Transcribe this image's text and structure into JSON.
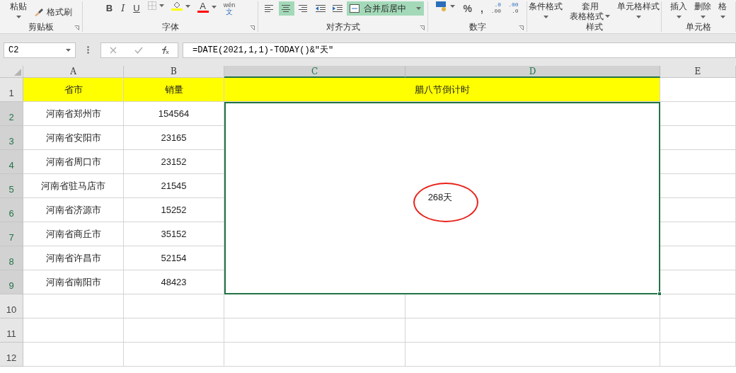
{
  "ribbon": {
    "groups": [
      {
        "label": "剪贴板",
        "launcher": true,
        "items": [
          {
            "kind": "stack",
            "label": "粘贴"
          },
          {
            "kind": "brush",
            "label": "格式刷"
          }
        ]
      },
      {
        "label": "字体",
        "launcher": true,
        "items": [
          {
            "kind": "bold",
            "label": "B"
          },
          {
            "kind": "italic",
            "label": "I"
          },
          {
            "kind": "underline",
            "label": "U"
          },
          {
            "kind": "border"
          },
          {
            "kind": "fill",
            "color": "#ffff00"
          },
          {
            "kind": "fontcolor",
            "label": "A",
            "color": "#ff0000"
          },
          {
            "kind": "phonetic",
            "label": "wén",
            "sub": "文"
          }
        ]
      },
      {
        "label": "对齐方式",
        "launcher": true,
        "items": [
          {
            "kind": "align-left",
            "selected": false
          },
          {
            "kind": "align-center",
            "selected": true
          },
          {
            "kind": "align-right",
            "selected": false
          },
          {
            "kind": "indent-dec",
            "selected": false
          },
          {
            "kind": "indent-inc",
            "selected": false
          },
          {
            "kind": "merge",
            "label": "合并后居中",
            "selected": true
          }
        ]
      },
      {
        "label": "数字",
        "launcher": true,
        "items": [
          {
            "kind": "currency"
          },
          {
            "kind": "char",
            "label": "%"
          },
          {
            "kind": "char",
            "label": ","
          },
          {
            "kind": "decimal-inc",
            "label": ".0",
            "sub": ".00"
          },
          {
            "kind": "decimal-dec",
            "label": ".00",
            "sub": ".0"
          }
        ]
      },
      {
        "label": "样式",
        "launcher": false,
        "items": [
          {
            "kind": "stack",
            "label": "条件格式"
          },
          {
            "kind": "stack2",
            "label": "套用",
            "sub": "表格格式"
          },
          {
            "kind": "stack",
            "label": "单元格样式"
          }
        ]
      },
      {
        "label": "单元格",
        "launcher": false,
        "items": [
          {
            "kind": "stack",
            "label": "插入"
          },
          {
            "kind": "stack",
            "label": "删除"
          },
          {
            "kind": "stack",
            "label": "格"
          }
        ]
      }
    ]
  },
  "name_box": "C2",
  "formula": "=DATE(2021,1,1)-TODAY()&\"天\"",
  "columns": [
    {
      "letter": "A",
      "selected": false
    },
    {
      "letter": "B",
      "selected": false
    },
    {
      "letter": "C",
      "selected": true
    },
    {
      "letter": "D",
      "selected": true
    },
    {
      "letter": "E",
      "selected": false
    }
  ],
  "header_row": {
    "number": "1",
    "selected": false,
    "cells": [
      "省市",
      "销量"
    ],
    "merged_title": "腊八节倒计时"
  },
  "merged_value": {
    "text": "268天",
    "circled": true
  },
  "rows": [
    {
      "number": "2",
      "selected": true,
      "cells": [
        "河南省郑州市",
        "154564"
      ]
    },
    {
      "number": "3",
      "selected": true,
      "cells": [
        "河南省安阳市",
        "23165"
      ]
    },
    {
      "number": "4",
      "selected": true,
      "cells": [
        "河南省周口市",
        "23152"
      ]
    },
    {
      "number": "5",
      "selected": true,
      "cells": [
        "河南省驻马店市",
        "21545"
      ]
    },
    {
      "number": "6",
      "selected": true,
      "cells": [
        "河南省济源市",
        "15252"
      ]
    },
    {
      "number": "7",
      "selected": true,
      "cells": [
        "河南省商丘市",
        "35152"
      ]
    },
    {
      "number": "8",
      "selected": true,
      "cells": [
        "河南省许昌市",
        "52154"
      ]
    },
    {
      "number": "9",
      "selected": true,
      "cells": [
        "河南省南阳市",
        "48423"
      ]
    }
  ],
  "empty_rows": [
    {
      "number": "10",
      "selected": false
    },
    {
      "number": "11",
      "selected": false
    },
    {
      "number": "12",
      "selected": false
    }
  ]
}
